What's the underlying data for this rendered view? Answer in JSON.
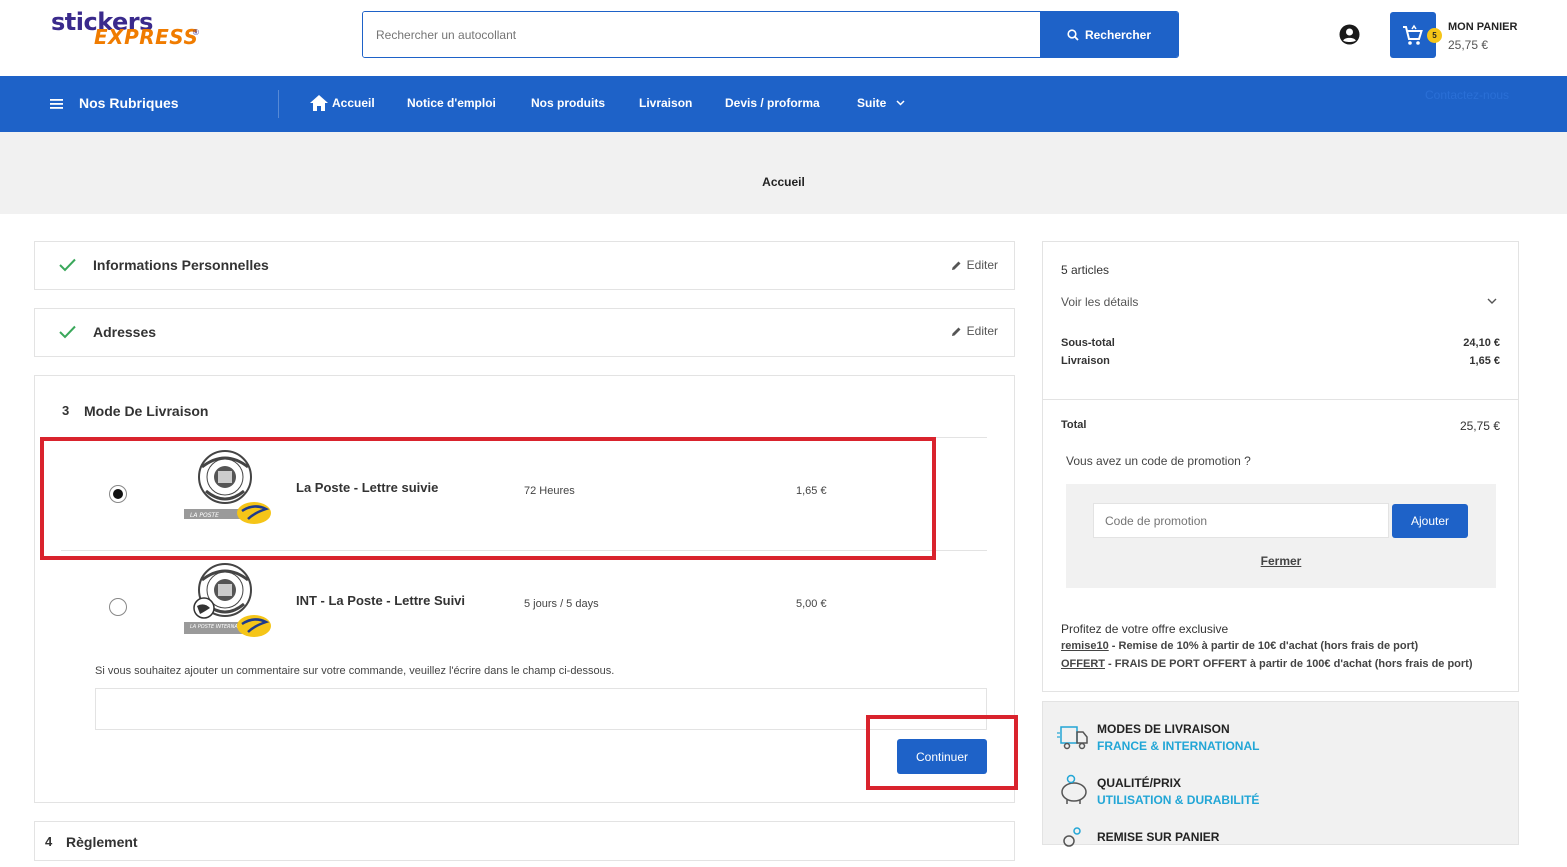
{
  "header": {
    "logo_top": "stickers",
    "logo_bottom": "EXPRESS",
    "logo_mark": "®",
    "search_placeholder": "Rechercher un autocollant",
    "search_button": "Rechercher",
    "cart_count": "5",
    "cart_title": "MON PANIER",
    "cart_total": "25,75 €"
  },
  "nav": {
    "rubriques": "Nos Rubriques",
    "items": [
      "Accueil",
      "Notice d'emploi",
      "Nos produits",
      "Livraison",
      "Devis / proforma",
      "Suite"
    ],
    "contact": "Contactez-nous"
  },
  "breadcrumb": "Accueil",
  "steps": {
    "personal": {
      "title": "Informations Personnelles",
      "edit": "Editer"
    },
    "addresses": {
      "title": "Adresses",
      "edit": "Editer"
    },
    "delivery": {
      "number": "3",
      "title": "Mode De Livraison"
    },
    "payment": {
      "number": "4",
      "title": "Règlement"
    }
  },
  "delivery_options": [
    {
      "name": "La Poste - Lettre suivie",
      "delay": "72 Heures",
      "price": "1,65 €",
      "selected": true,
      "logo_caption": "LA POSTE"
    },
    {
      "name": "INT - La Poste - Lettre Suivi",
      "delay": "5 jours / 5 days",
      "price": "5,00 €",
      "selected": false,
      "logo_caption": "LA POSTE INTERNATIONAL"
    }
  ],
  "comment": {
    "label": "Si vous souhaitez ajouter un commentaire sur votre commande, veuillez l'écrire dans le champ ci-dessous.",
    "value": ""
  },
  "continue_button": "Continuer",
  "summary": {
    "articles": "5 articles",
    "details": "Voir les détails",
    "subtotal_label": "Sous-total",
    "subtotal_value": "24,10 €",
    "shipping_label": "Livraison",
    "shipping_value": "1,65 €",
    "total_label": "Total",
    "total_value": "25,75 €",
    "promo_question": "Vous avez un code de promotion ?",
    "promo_placeholder": "Code de promotion",
    "promo_button": "Ajouter",
    "promo_close": "Fermer",
    "offer_title": "Profitez de votre offre exclusive",
    "offers": [
      {
        "code": "remise10",
        "text": " - Remise de 10% à partir de 10€ d'achat (hors frais de port)"
      },
      {
        "code": "OFFERT",
        "text": " - FRAIS DE PORT OFFERT à partir de 100€ d'achat (hors frais de port)"
      }
    ]
  },
  "reassurance": [
    {
      "title": "MODES DE LIVRAISON",
      "subtitle": "FRANCE & INTERNATIONAL"
    },
    {
      "title": "QUALITÉ/PRIX",
      "subtitle": "UTILISATION & DURABILITÉ"
    },
    {
      "title": "REMISE SUR PANIER",
      "subtitle": ""
    }
  ],
  "colors": {
    "primary": "#1e62c8",
    "annotation": "#d9232d",
    "check": "#3aa85b",
    "accent_orange": "#f07c00",
    "accent_cyan": "#22a6d6",
    "badge": "#f5c518"
  }
}
